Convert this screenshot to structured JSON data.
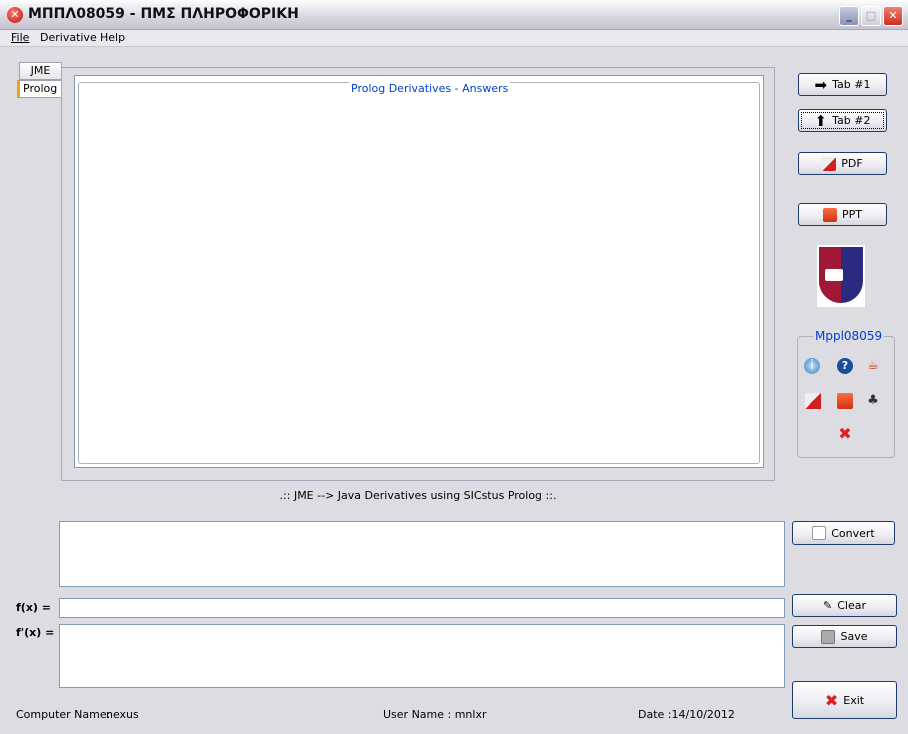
{
  "window": {
    "title": "ΜΠΠΛ08059 - ΠΜΣ ΠΛΗΡΟΦΟΡΙΚΗ",
    "minimize": "_",
    "maximize": "□",
    "close": "✕"
  },
  "menu": [
    {
      "label": "File"
    },
    {
      "label": "Derivative"
    },
    {
      "label": "Help"
    }
  ],
  "tabs": [
    {
      "label": "JME"
    },
    {
      "label": "Prolog",
      "selected": true
    }
  ],
  "answers_panel": {
    "title": "Prolog Derivatives - Answers",
    "content": ""
  },
  "right_buttons": {
    "tab1": "Tab #1",
    "tab2": "Tab #2",
    "pdf": "PDF",
    "ppt": "PPT"
  },
  "group": {
    "title": "Mppl08059",
    "icons": [
      "info-icon",
      "help-icon",
      "java-icon",
      "pdf-icon",
      "ppt-icon",
      "club-icon",
      "close-icon"
    ]
  },
  "caption": ".:: JME --> Java Derivatives using SICstus Prolog ::.",
  "input": {
    "value": "",
    "fx_label": "f(x) =",
    "fx_value": "",
    "dfx_label": "f'(x) =",
    "dfx_value": ""
  },
  "actions": {
    "convert": "Convert",
    "clear": "Clear",
    "save": "Save",
    "exit": "Exit"
  },
  "footer": {
    "computer_label": "Computer Name:",
    "computer_value": "nexus",
    "user": "User Name : mnlxr",
    "date": "Date :14/10/2012"
  },
  "colors": {
    "accent": "#0040d0",
    "tab_selected": "#f0a020"
  }
}
